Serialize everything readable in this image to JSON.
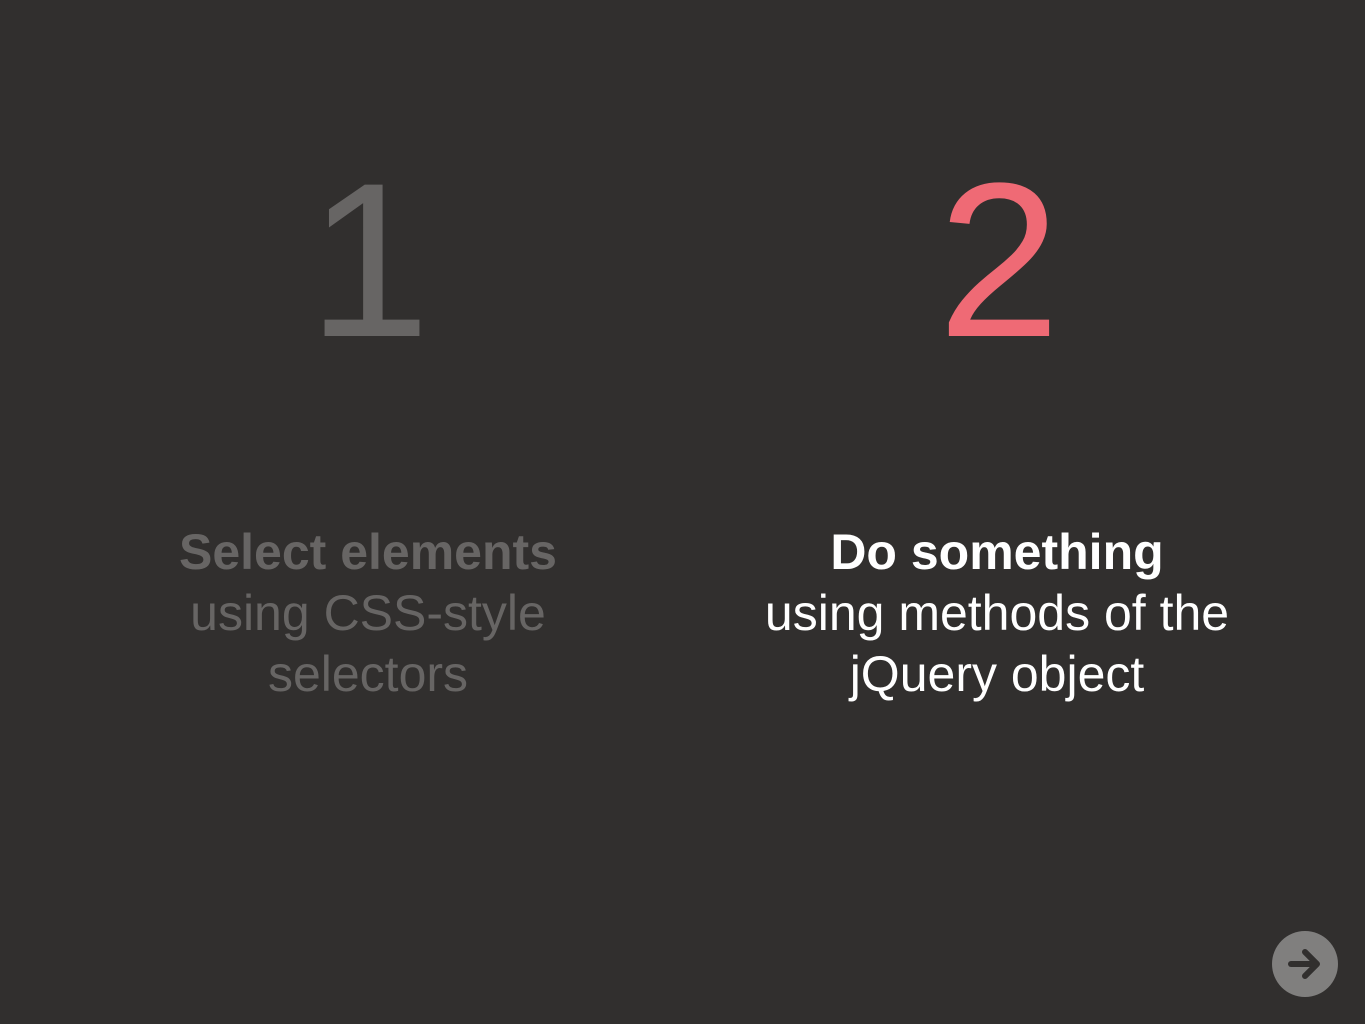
{
  "steps": [
    {
      "number": "1",
      "title": "Select elements",
      "description": "using CSS-style selectors",
      "state": "dimmed"
    },
    {
      "number": "2",
      "title": "Do something",
      "description": "using methods of the jQuery object",
      "state": "active"
    }
  ],
  "navigation": {
    "next_icon": "arrow-right-icon"
  },
  "colors": {
    "background": "#312f2e",
    "dimmed": "#676564",
    "accent": "#ef6a75",
    "active_text": "#ffffff",
    "button": "#807f7e"
  }
}
